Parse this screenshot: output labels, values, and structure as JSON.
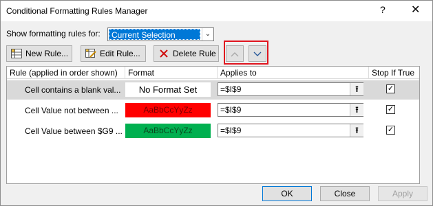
{
  "window": {
    "title": "Conditional Formatting Rules Manager",
    "help_glyph": "?",
    "close_glyph": "✕"
  },
  "show_rules": {
    "label": "Show formatting rules for:",
    "value": "Current Selection",
    "arrow": "⌄"
  },
  "toolbar": {
    "new_rule": "New Rule...",
    "edit_rule": "Edit Rule...",
    "delete_rule": "Delete Rule",
    "move_up_glyph": "⌃",
    "move_down_glyph": "⌄"
  },
  "columns": {
    "rule": "Rule (applied in order shown)",
    "format": "Format",
    "applies_to": "Applies to",
    "stop_if_true": "Stop If True"
  },
  "rows": [
    {
      "rule": "Cell contains a blank val...",
      "format_preview": "No Format Set",
      "format_bg": "#ffffff",
      "format_color": "#000000",
      "applies_to": "=$I$9",
      "stop_if_true": true
    },
    {
      "rule": "Cell Value not between ...",
      "format_preview": "AaBbCcYyZz",
      "format_bg": "#ff0000",
      "format_color": "#7a0000",
      "applies_to": "=$I$9",
      "stop_if_true": true
    },
    {
      "rule": "Cell Value between $G9 ...",
      "format_preview": "AaBbCcYyZz",
      "format_bg": "#00b050",
      "format_color": "#0a4a1f",
      "applies_to": "=$I$9",
      "stop_if_true": true
    }
  ],
  "collapse_glyph": "⭱",
  "check_glyph": "✓",
  "buttons": {
    "ok": "OK",
    "close": "Close",
    "apply": "Apply"
  },
  "colors": {
    "selection": "#0078d7",
    "highlight_box": "#e0141e"
  }
}
